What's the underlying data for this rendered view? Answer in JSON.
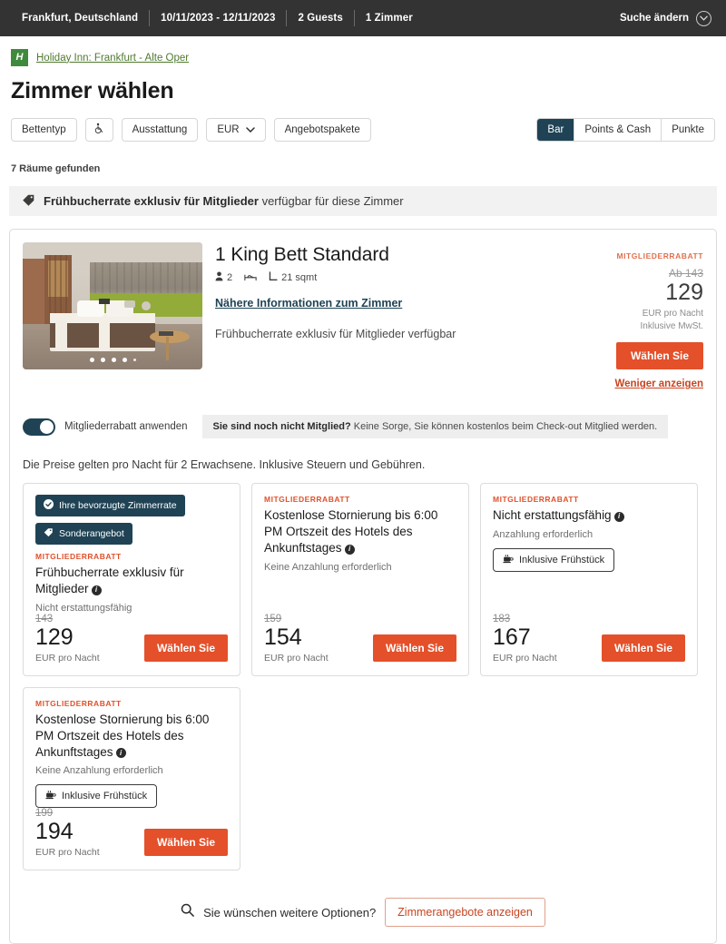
{
  "topbar": {
    "destination": "Frankfurt, Deutschland",
    "dates": "10/11/2023 - 12/11/2023",
    "guests": "2 Guests",
    "rooms": "1 Zimmer",
    "change_search": "Suche ändern"
  },
  "breadcrumb": {
    "logo_text": "H",
    "hotel_name": "Holiday Inn: Frankfurt - Alte Oper"
  },
  "header": {
    "title": "Zimmer wählen"
  },
  "filters": {
    "bed_type": "Bettentyp",
    "accessibility_icon": "wheelchair-icon",
    "amenities": "Ausstattung",
    "currency": "EUR",
    "packages": "Angebotspakete"
  },
  "payment_tabs": [
    {
      "label": "Bar",
      "active": true
    },
    {
      "label": "Points & Cash",
      "active": false
    },
    {
      "label": "Punkte",
      "active": false
    }
  ],
  "results": {
    "count_text": "7 Räume gefunden",
    "promo_bold": "Frühbucherrate exklusiv für Mitglieder",
    "promo_rest": " verfügbar für diese Zimmer"
  },
  "room": {
    "name": "1 King Bett Standard",
    "occupancy": "2",
    "size": "21 sqmt",
    "details_link": "Nähere Informationen zum Zimmer",
    "subtitle": "Frühbucherrate exklusiv für Mitglieder verfügbar",
    "carousel_dots": 5,
    "price": {
      "member_label": "MITGLIEDERRABATT",
      "strike": "Ab 143",
      "amount": "129",
      "unit_line1": "EUR pro Nacht",
      "unit_line2": "Inklusive MwSt.",
      "select_button": "Wählen Sie",
      "less_link": "Weniger anzeigen"
    }
  },
  "member_toggle": {
    "label": "Mitgliederrabatt anwenden",
    "note_bold": "Sie sind noch nicht Mitglied?",
    "note_rest": " Keine Sorge, Sie können kostenlos beim Check-out Mitglied werden.",
    "enabled": true
  },
  "price_note": "Die Preise gelten pro Nacht für 2 Erwachsene. Inklusive Steuern und Gebühren.",
  "rates": [
    {
      "badges": [
        "Ihre bevorzugte Zimmerrate",
        "Sonderangebot"
      ],
      "member_label": "MITGLIEDERRABATT",
      "title": "Frühbucherrate exklusiv für Mitglieder",
      "sub": "Nicht erstattungsfähig",
      "breakfast": null,
      "strike": "143",
      "amount": "129",
      "unit": "EUR pro Nacht",
      "select_button": "Wählen Sie"
    },
    {
      "badges": [],
      "member_label": "MITGLIEDERRABATT",
      "title": "Kostenlose Stornierung bis 6:00 PM Ortszeit des Hotels des Ankunftstages",
      "sub": "Keine Anzahlung erforderlich",
      "breakfast": null,
      "strike": "159",
      "amount": "154",
      "unit": "EUR pro Nacht",
      "select_button": "Wählen Sie"
    },
    {
      "badges": [],
      "member_label": "MITGLIEDERRABATT",
      "title": "Nicht erstattungsfähig",
      "sub": "Anzahlung erforderlich",
      "breakfast": "Inklusive Frühstück",
      "strike": "183",
      "amount": "167",
      "unit": "EUR pro Nacht",
      "select_button": "Wählen Sie"
    },
    {
      "badges": [],
      "member_label": "MITGLIEDERRABATT",
      "title": "Kostenlose Stornierung bis 6:00 PM Ortszeit des Hotels des Ankunftstages",
      "sub": "Keine Anzahlung erforderlich",
      "breakfast": "Inklusive Frühstück",
      "strike": "199",
      "amount": "194",
      "unit": "EUR pro Nacht",
      "select_button": "Wählen Sie"
    }
  ],
  "footer": {
    "more_text": "Sie wünschen weitere Optionen?",
    "more_button": "Zimmerangebote anzeigen"
  },
  "colors": {
    "orange": "#e4502a",
    "navy": "#1f4355",
    "green": "#3f8a3d",
    "topbar": "#333333"
  }
}
